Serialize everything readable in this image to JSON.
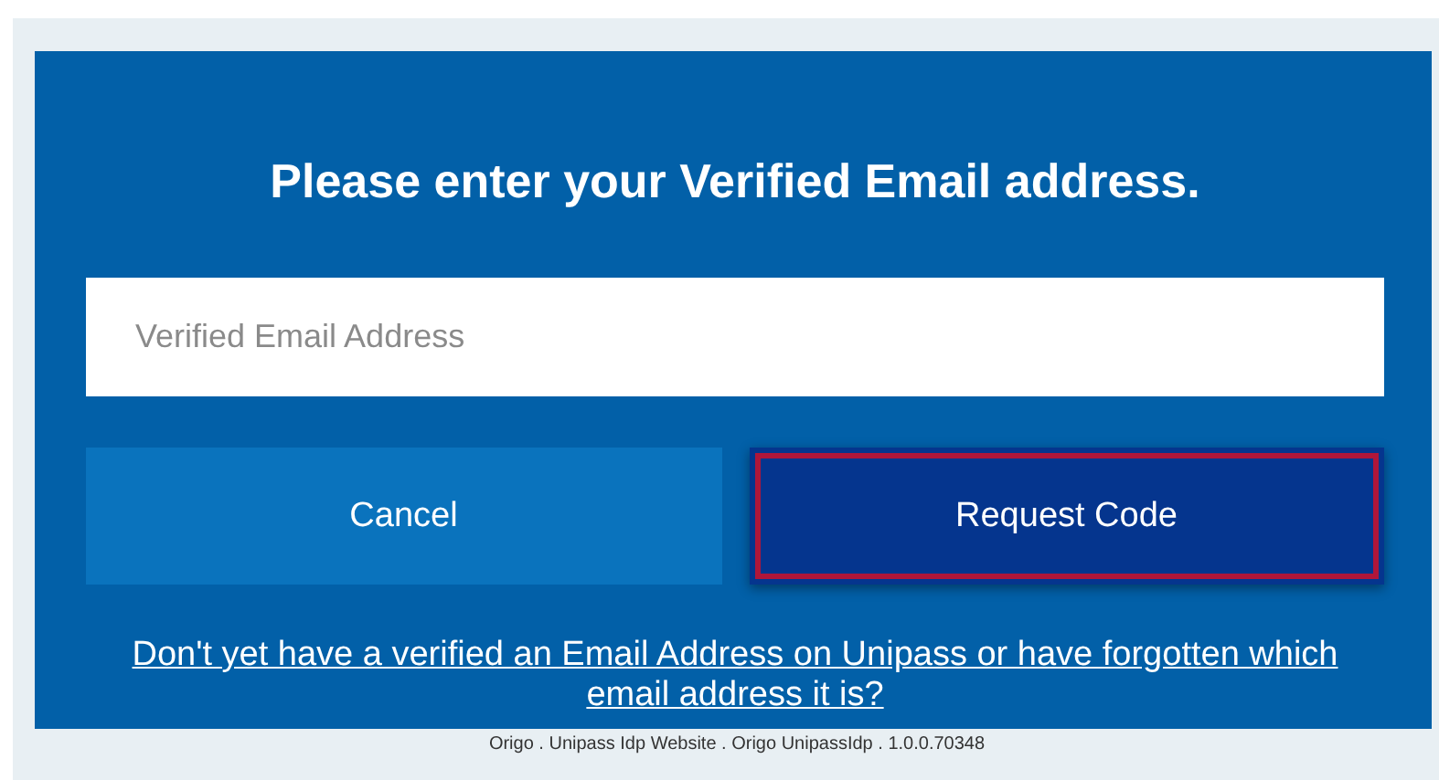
{
  "heading": "Please enter your Verified Email address.",
  "email_field": {
    "placeholder": "Verified Email Address"
  },
  "buttons": [
    {
      "label": "Cancel",
      "kind": "secondary",
      "focused": false
    },
    {
      "label": "Request Code",
      "kind": "primary",
      "focused": true
    }
  ],
  "help_link": "Don't yet have a verified an Email Address on Unipass or have forgotten which email address it is?",
  "footer": "Origo . Unipass Idp Website . Origo UnipassIdp . 1.0.0.70348"
}
